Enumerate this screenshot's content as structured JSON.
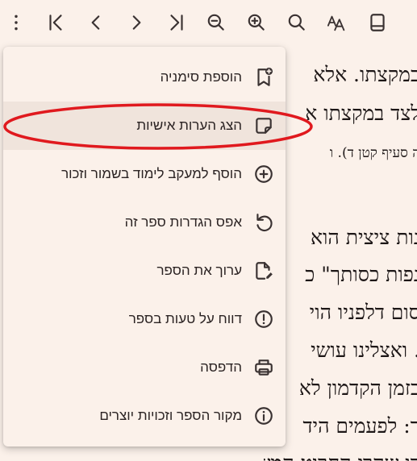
{
  "menu": {
    "items": [
      {
        "label": "הוספת סימניה",
        "icon": "bookmark-add-icon"
      },
      {
        "label": "הצג הערות אישיות",
        "icon": "sticky-note-icon"
      },
      {
        "label": "הוסף למעקב לימוד בשמור וזכור",
        "icon": "plus-circle-icon"
      },
      {
        "label": "אפס הגדרות ספר זה",
        "icon": "reset-icon"
      },
      {
        "label": "ערוך את הספר",
        "icon": "edit-document-icon"
      },
      {
        "label": "דווח על טעות בספר",
        "icon": "alert-circle-icon"
      },
      {
        "label": "הדפסה",
        "icon": "printer-icon"
      },
      {
        "label": "מקור הספר וזכויות יוצרים",
        "icon": "info-circle-icon"
      }
    ]
  },
  "book_text": {
    "lines": [
      "במקצתו. אלא",
      "לצד במקצתו א",
      "ה סעיף קטן ד). ו",
      "נות ציצית הוא",
      "נפות כסותך\" כ",
      "סום דלפניו הוי",
      ". ואצלינו עושי",
      "בזמן הקדמון לא",
      "ר: לפעמים היד",
      "רו שהרי החרוט המשפט לאחד השנה"
    ]
  },
  "toolbar": {
    "icons": [
      "more-vertical-icon",
      "first-page-icon",
      "previous-page-icon",
      "next-page-icon",
      "last-page-icon",
      "zoom-out-icon",
      "zoom-in-icon",
      "search-icon",
      "font-settings-icon",
      "tablet-view-icon"
    ]
  },
  "colors": {
    "background": "#fbf1ea",
    "highlight": "#f0e4dc",
    "annotation": "#e0191e"
  }
}
